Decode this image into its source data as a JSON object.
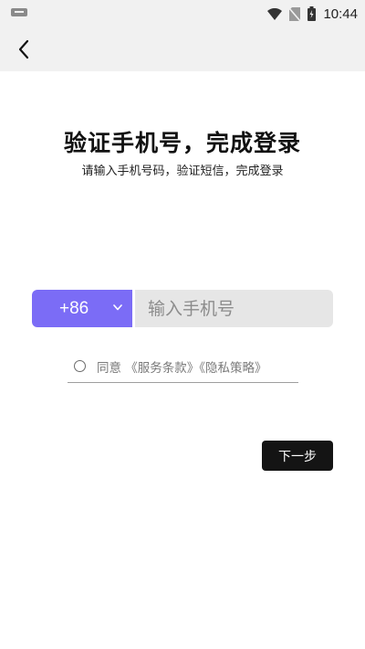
{
  "status_bar": {
    "time": "10:44",
    "icons": [
      "keyboard-icon",
      "wifi-icon",
      "no-sim-icon",
      "battery-charging-icon"
    ]
  },
  "top_bar": {
    "back_icon": "chevron-left-icon"
  },
  "login": {
    "title": "验证手机号，完成登录",
    "subtitle": "请输入手机号码，验证短信，完成登录",
    "country_code": "+86",
    "phone_placeholder": "输入手机号",
    "phone_value": "",
    "agree_prefix": "同意",
    "terms_link": "《服务条款》",
    "privacy_link": "《隐私策略》",
    "next_button": "下一步"
  },
  "colors": {
    "accent": "#7b6cf6",
    "button": "#141414",
    "input_bg": "#e6e6e6",
    "bar_bg": "#f1f1f1"
  }
}
